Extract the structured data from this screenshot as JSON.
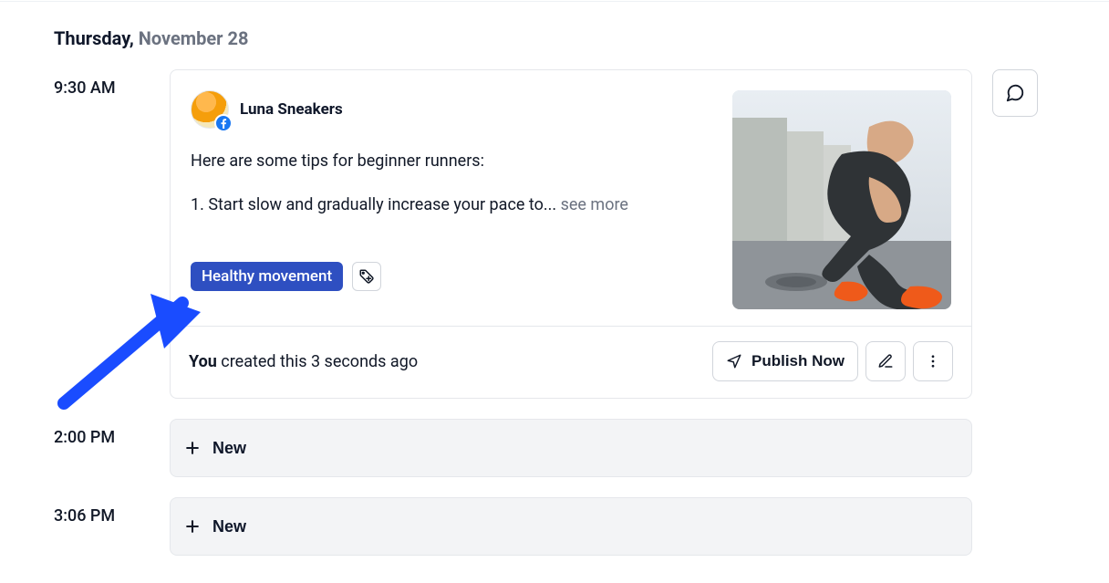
{
  "date": {
    "weekday": "Thursday,",
    "rest": "November 28"
  },
  "post": {
    "time": "9:30 AM",
    "account": "Luna Sneakers",
    "network_icon": "facebook",
    "body_line1": "Here are some tips for beginner runners:",
    "body_line2": "1. Start slow and gradually increase your pace to... ",
    "see_more": "see more",
    "tag": "Healthy movement",
    "meta_who": "You",
    "meta_rest": " created this 3 seconds ago",
    "publish_label": "Publish Now"
  },
  "slots": [
    {
      "time": "2:00 PM",
      "label": "New"
    },
    {
      "time": "3:06 PM",
      "label": "New"
    }
  ]
}
